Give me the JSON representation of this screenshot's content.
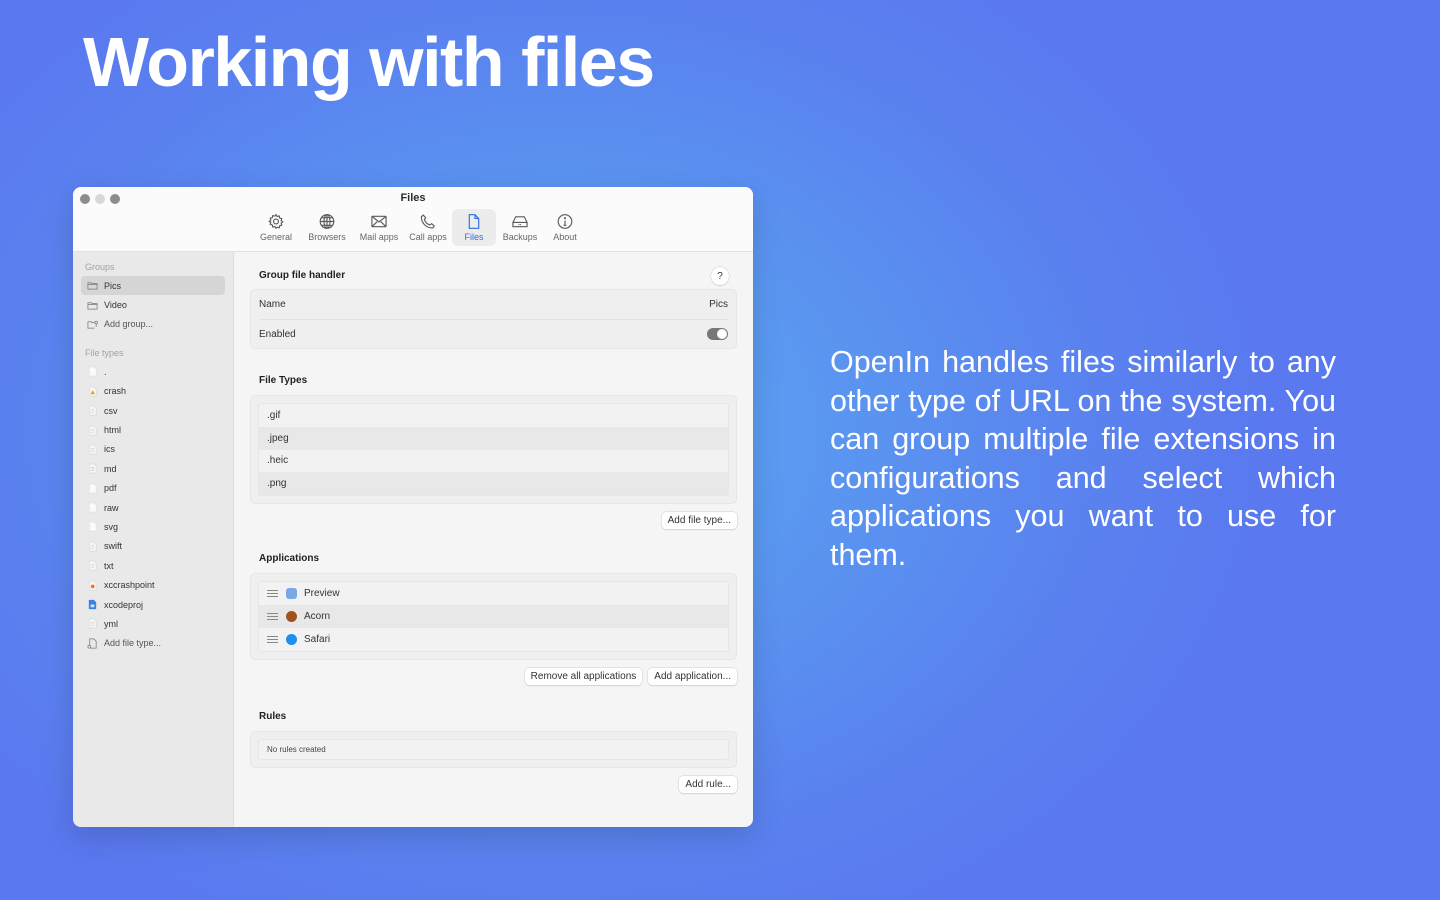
{
  "hero": {
    "title": "Working with files",
    "description": "OpenIn handles files similarly to any other type of URL on the system. You can group multiple file extensions in configurations and select which applications you want to use for them."
  },
  "window": {
    "title": "Files",
    "toolbar": [
      {
        "label": "General",
        "icon": "gear-icon"
      },
      {
        "label": "Browsers",
        "icon": "globe-icon"
      },
      {
        "label": "Mail apps",
        "icon": "envelope-icon"
      },
      {
        "label": "Call apps",
        "icon": "phone-icon"
      },
      {
        "label": "Files",
        "icon": "document-icon",
        "active": true
      },
      {
        "label": "Backups",
        "icon": "drive-icon"
      },
      {
        "label": "About",
        "icon": "info-icon"
      }
    ],
    "accent_color": "#2a6de3"
  },
  "sidebar": {
    "groups_header": "Groups",
    "groups": [
      {
        "label": "Pics",
        "selected": true
      },
      {
        "label": "Video"
      }
    ],
    "add_group": "Add group...",
    "file_types_header": "File types",
    "file_types": [
      {
        "label": ".",
        "icon": "blank-file-icon"
      },
      {
        "label": "crash",
        "icon": "crash-report-icon"
      },
      {
        "label": "csv",
        "icon": "text-file-icon"
      },
      {
        "label": "html",
        "icon": "text-file-icon"
      },
      {
        "label": "ics",
        "icon": "text-file-icon"
      },
      {
        "label": "md",
        "icon": "markdown-file-icon"
      },
      {
        "label": "pdf",
        "icon": "blank-file-icon"
      },
      {
        "label": "raw",
        "icon": "blank-file-icon"
      },
      {
        "label": "svg",
        "icon": "blank-file-icon"
      },
      {
        "label": "swift",
        "icon": "text-file-icon"
      },
      {
        "label": "txt",
        "icon": "text-file-icon"
      },
      {
        "label": "xccrashpoint",
        "icon": "crash-point-icon"
      },
      {
        "label": "xcodeproj",
        "icon": "xcode-project-icon"
      },
      {
        "label": "yml",
        "icon": "text-file-icon"
      }
    ],
    "add_file_type": "Add file type..."
  },
  "handler": {
    "title": "Group file handler",
    "help_label": "?",
    "name_label": "Name",
    "name_value": "Pics",
    "enabled_label": "Enabled",
    "enabled": true
  },
  "file_types_section": {
    "title": "File Types",
    "items": [
      ".gif",
      ".jpeg",
      ".heic",
      ".png"
    ],
    "add_button": "Add file type..."
  },
  "applications_section": {
    "title": "Applications",
    "items": [
      {
        "name": "Preview",
        "icon": "preview-app-icon",
        "color": "#7aa7e6"
      },
      {
        "name": "Acorn",
        "icon": "acorn-app-icon",
        "color": "#a0521d"
      },
      {
        "name": "Safari",
        "icon": "safari-app-icon",
        "color": "#1f8ef0"
      }
    ],
    "remove_all_button": "Remove all applications",
    "add_button": "Add application..."
  },
  "rules_section": {
    "title": "Rules",
    "empty_text": "No rules created",
    "add_button": "Add rule..."
  }
}
